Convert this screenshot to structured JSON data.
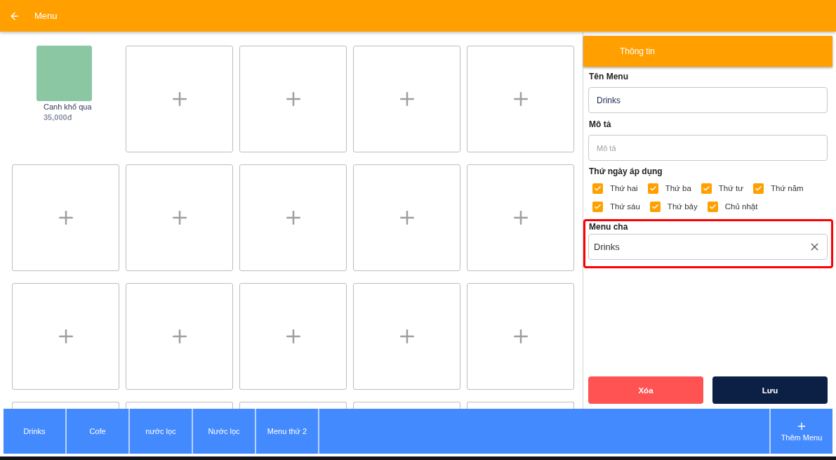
{
  "top_bar": {
    "title": "Menu"
  },
  "grid": {
    "slots": [
      {
        "kind": "item",
        "name": "Canh khổ qua",
        "price": "35,000đ"
      },
      {
        "kind": "empty"
      },
      {
        "kind": "empty"
      },
      {
        "kind": "empty"
      },
      {
        "kind": "empty"
      },
      {
        "kind": "empty"
      },
      {
        "kind": "empty"
      },
      {
        "kind": "empty"
      },
      {
        "kind": "empty"
      },
      {
        "kind": "empty"
      },
      {
        "kind": "empty"
      },
      {
        "kind": "empty"
      },
      {
        "kind": "empty"
      },
      {
        "kind": "empty"
      },
      {
        "kind": "empty"
      },
      {
        "kind": "empty"
      },
      {
        "kind": "empty"
      },
      {
        "kind": "empty"
      },
      {
        "kind": "empty"
      },
      {
        "kind": "empty"
      }
    ]
  },
  "info_panel": {
    "title": "Thông tin",
    "fields": [
      {
        "label": "Tên Menu",
        "value": "Drinks"
      },
      {
        "label": "Mô tả",
        "placeholder": "Mô tả"
      }
    ],
    "days": {
      "label": "Thứ ngày áp dụng",
      "options": [
        {
          "label": "Thứ hai",
          "checked": true
        },
        {
          "label": "Thứ ba",
          "checked": true
        },
        {
          "label": "Thứ tư",
          "checked": true
        },
        {
          "label": "Thứ năm",
          "checked": true
        },
        {
          "label": "Thứ sáu",
          "checked": true
        },
        {
          "label": "Thứ bảy",
          "checked": true
        },
        {
          "label": "Chủ nhật",
          "checked": true
        }
      ]
    },
    "parent_menu": {
      "label": "Menu cha",
      "value": "Drinks",
      "highlighted": true
    },
    "buttons": [
      {
        "kind": "delete",
        "label": "Xóa"
      },
      {
        "kind": "save",
        "label": "Lưu"
      }
    ]
  },
  "menu_tabs": {
    "tabs": [
      {
        "label": "Drinks",
        "selected": false
      },
      {
        "label": "Cofe",
        "selected": false
      },
      {
        "label": "nước lọc",
        "selected": false
      },
      {
        "label": "Nước lọc",
        "selected": false
      },
      {
        "label": "Menu thứ 2",
        "selected": false
      }
    ],
    "add_button": {
      "label": "Thêm Menu"
    }
  }
}
